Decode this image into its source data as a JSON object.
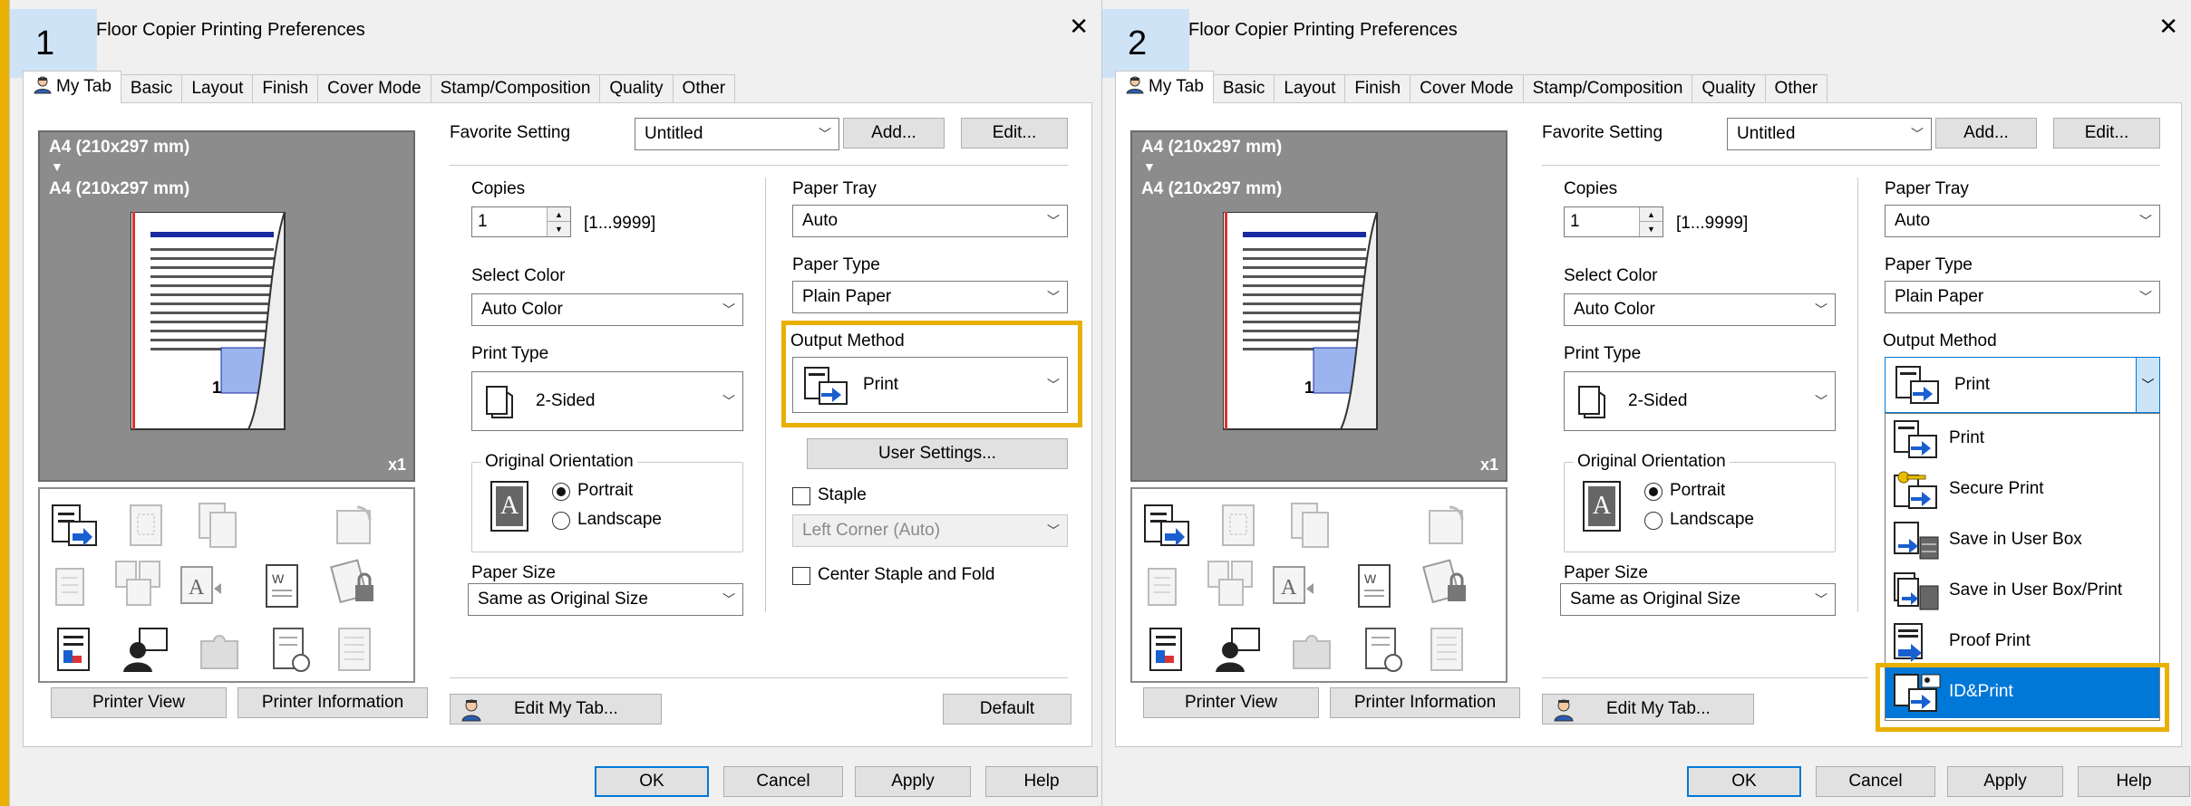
{
  "panels": [
    {
      "badge": "1",
      "title": "Floor Copier Printing Preferences",
      "tabs": [
        "My Tab",
        "Basic",
        "Layout",
        "Finish",
        "Cover Mode",
        "Stamp/Composition",
        "Quality",
        "Other"
      ],
      "preview": {
        "line1": "A4 (210x297 mm)",
        "arrow": "▼",
        "line2": "A4 (210x297 mm)",
        "scale": "x1"
      },
      "left_buttons": {
        "printer_view": "Printer View",
        "printer_info": "Printer Information"
      },
      "favorite": {
        "label": "Favorite Setting",
        "value": "Untitled",
        "add": "Add...",
        "edit": "Edit..."
      },
      "copies": {
        "label": "Copies",
        "value": "1",
        "range": "[1...9999]"
      },
      "select_color": {
        "label": "Select Color",
        "value": "Auto Color"
      },
      "print_type": {
        "label": "Print Type",
        "value": "2-Sided"
      },
      "orientation": {
        "label": "Original Orientation",
        "portrait": "Portrait",
        "landscape": "Landscape",
        "glyph": "A"
      },
      "paper_size": {
        "label": "Paper Size",
        "value": "Same as Original Size"
      },
      "paper_tray": {
        "label": "Paper Tray",
        "value": "Auto"
      },
      "paper_type": {
        "label": "Paper Type",
        "value": "Plain Paper"
      },
      "output_method": {
        "label": "Output Method",
        "value": "Print"
      },
      "user_settings": "User Settings...",
      "staple": {
        "label": "Staple",
        "value": "Left Corner (Auto)"
      },
      "center_staple": "Center Staple and Fold",
      "edit_my_tab": "Edit My Tab...",
      "default_btn": "Default",
      "footer": {
        "ok": "OK",
        "cancel": "Cancel",
        "apply": "Apply",
        "help": "Help"
      }
    },
    {
      "badge": "2",
      "title": "Floor Copier Printing Preferences",
      "tabs": [
        "My Tab",
        "Basic",
        "Layout",
        "Finish",
        "Cover Mode",
        "Stamp/Composition",
        "Quality",
        "Other"
      ],
      "preview": {
        "line1": "A4 (210x297 mm)",
        "arrow": "▼",
        "line2": "A4 (210x297 mm)",
        "scale": "x1"
      },
      "left_buttons": {
        "printer_view": "Printer View",
        "printer_info": "Printer Information"
      },
      "favorite": {
        "label": "Favorite Setting",
        "value": "Untitled",
        "add": "Add...",
        "edit": "Edit..."
      },
      "copies": {
        "label": "Copies",
        "value": "1",
        "range": "[1...9999]"
      },
      "select_color": {
        "label": "Select Color",
        "value": "Auto Color"
      },
      "print_type": {
        "label": "Print Type",
        "value": "2-Sided"
      },
      "orientation": {
        "label": "Original Orientation",
        "portrait": "Portrait",
        "landscape": "Landscape",
        "glyph": "A"
      },
      "paper_size": {
        "label": "Paper Size",
        "value": "Same as Original Size"
      },
      "paper_tray": {
        "label": "Paper Tray",
        "value": "Auto"
      },
      "paper_type": {
        "label": "Paper Type",
        "value": "Plain Paper"
      },
      "output_method": {
        "label": "Output Method",
        "value": "Print"
      },
      "output_options": [
        "Print",
        "Secure Print",
        "Save in User Box",
        "Save in User Box/Print",
        "Proof Print",
        "ID&Print"
      ],
      "edit_my_tab": "Edit My Tab...",
      "footer": {
        "ok": "OK",
        "cancel": "Cancel",
        "apply": "Apply",
        "help": "Help"
      }
    }
  ],
  "colors": {
    "highlight": "#e8b000",
    "selection": "#0078d7",
    "badge": "#cfe3f7"
  }
}
